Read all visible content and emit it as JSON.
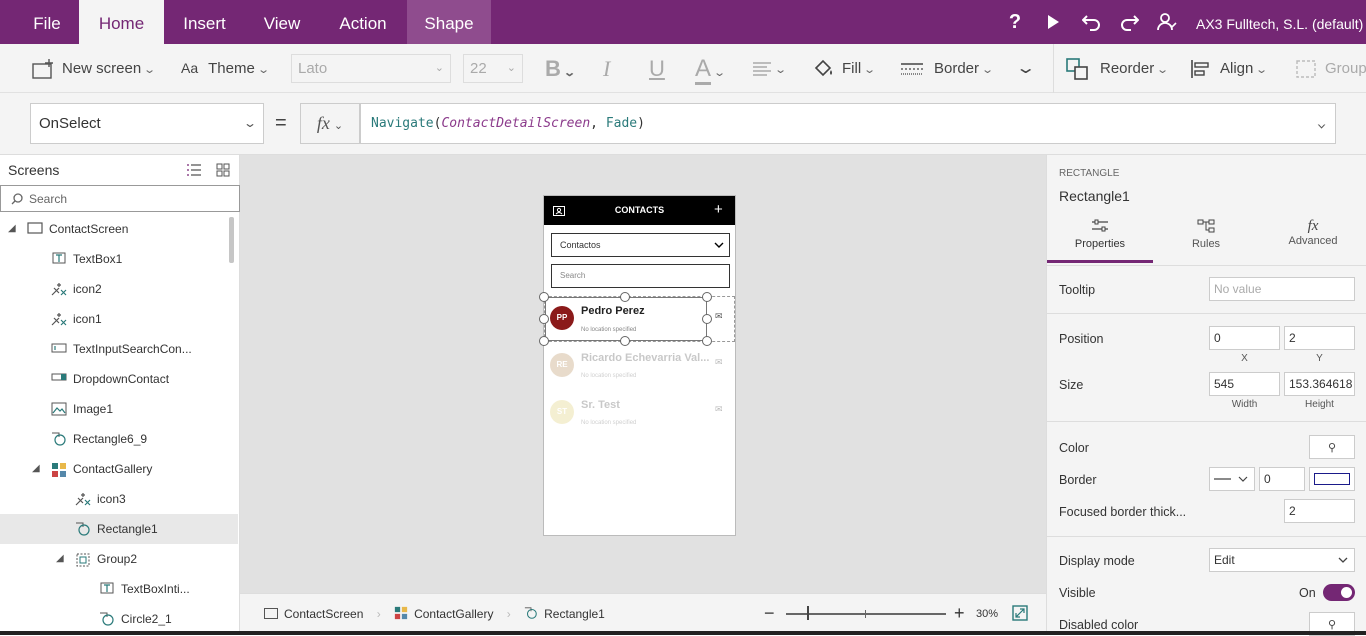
{
  "menu": {
    "tabs": [
      "File",
      "Home",
      "Insert",
      "View",
      "Action",
      "Shape"
    ],
    "account": "AX3 Fulltech, S.L. (default)"
  },
  "ribbon": {
    "new_screen": "New screen",
    "theme": "Theme",
    "font": "Lato",
    "font_size": "22",
    "bold": "B",
    "italic": "I",
    "underline": "U",
    "font_color": "A",
    "fill": "Fill",
    "border": "Border",
    "reorder": "Reorder",
    "align": "Align",
    "group": "Group"
  },
  "formula": {
    "property": "OnSelect",
    "equals": "=",
    "fx": "fx",
    "func": "Navigate",
    "arg1": "ContactDetailScreen",
    "arg2": "Fade"
  },
  "left_panel": {
    "title": "Screens",
    "search_placeholder": "Search",
    "items": [
      {
        "label": "ContactScreen"
      },
      {
        "label": "TextBox1"
      },
      {
        "label": "icon2"
      },
      {
        "label": "icon1"
      },
      {
        "label": "TextInputSearchCon..."
      },
      {
        "label": "DropdownContact"
      },
      {
        "label": "Image1"
      },
      {
        "label": "Rectangle6_9"
      },
      {
        "label": "ContactGallery"
      },
      {
        "label": "icon3"
      },
      {
        "label": "Rectangle1"
      },
      {
        "label": "Group2"
      },
      {
        "label": "TextBoxInti..."
      },
      {
        "label": "Circle2_1"
      }
    ]
  },
  "app_preview": {
    "header_title": "CONTACTS",
    "dropdown_value": "Contactos",
    "search_placeholder": "Search",
    "contacts": [
      {
        "initials": "PP",
        "name": "Pedro Perez",
        "location": "No location specified",
        "color": "#8b1a1a"
      },
      {
        "initials": "RE",
        "name": "Ricardo Echevarria Val...",
        "location": "No location specified",
        "color": "#d8c2a8"
      },
      {
        "initials": "ST",
        "name": "Sr. Test",
        "location": "No location specified",
        "color": "#eee6b8"
      }
    ]
  },
  "bottom_bar": {
    "crumbs": [
      "ContactScreen",
      "ContactGallery",
      "Rectangle1"
    ],
    "zoom": "30%"
  },
  "right_panel": {
    "type_label": "RECTANGLE",
    "name": "Rectangle1",
    "tabs": [
      "Properties",
      "Rules",
      "Advanced"
    ],
    "tooltip_label": "Tooltip",
    "tooltip_placeholder": "No value",
    "position_label": "Position",
    "pos_x": "0",
    "pos_y": "2",
    "x_label": "X",
    "y_label": "Y",
    "size_label": "Size",
    "width": "545",
    "height": "153.364618",
    "width_label": "Width",
    "height_label": "Height",
    "color_label": "Color",
    "border_label": "Border",
    "border_width": "0",
    "focused_border_label": "Focused border thick...",
    "focused_border_value": "2",
    "display_mode_label": "Display mode",
    "display_mode_value": "Edit",
    "visible_label": "Visible",
    "visible_value": "On",
    "disabled_color_label": "Disabled color"
  },
  "colors": {
    "brand": "#742774",
    "accent_tab": "#8f4c8e"
  }
}
